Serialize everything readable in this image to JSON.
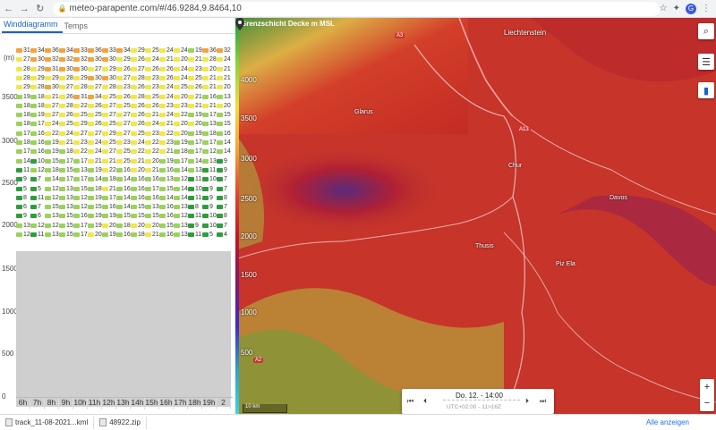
{
  "browser": {
    "url": "meteo-parapente.com/#/46.9284,9.8464,10",
    "back_icon": "arrow-left-icon",
    "forward_icon": "arrow-right-icon",
    "reload_icon": "reload-icon",
    "avatar_letter": "G"
  },
  "tabs": [
    {
      "label": "Winddiagramm",
      "active": true
    },
    {
      "label": "Temps",
      "active": false
    }
  ],
  "diagram": {
    "unit_label": "(m)",
    "y_labels": [
      "3500",
      "3000",
      "2500",
      "2000",
      "1500",
      "1000",
      "500",
      "0"
    ],
    "x_labels": [
      "6h",
      "7h",
      "8h",
      "9h",
      "10h",
      "11h",
      "12h",
      "13h",
      "14h",
      "15h",
      "16h",
      "17h",
      "18h",
      "19h",
      "2"
    ],
    "rows": [
      [
        "31",
        "34",
        "36",
        "34",
        "33",
        "36",
        "33",
        "34",
        "29",
        "25",
        "24",
        "24",
        "19",
        "36",
        "32"
      ],
      [
        "27",
        "30",
        "32",
        "32",
        "32",
        "30",
        "30",
        "29",
        "26",
        "24",
        "21",
        "20",
        "21",
        "28",
        "24"
      ],
      [
        "28",
        "29",
        "31",
        "30",
        "30",
        "27",
        "29",
        "26",
        "27",
        "26",
        "26",
        "24",
        "23",
        "20",
        "21"
      ],
      [
        "28",
        "29",
        "29",
        "28",
        "29",
        "30",
        "30",
        "27",
        "28",
        "23",
        "26",
        "24",
        "25",
        "21",
        "21"
      ],
      [
        "29",
        "28",
        "30",
        "27",
        "28",
        "27",
        "28",
        "23",
        "26",
        "23",
        "24",
        "25",
        "26",
        "21",
        "20"
      ],
      [
        "19",
        "18",
        "21",
        "26",
        "31",
        "34",
        "25",
        "26",
        "28",
        "25",
        "24",
        "20",
        "21",
        "16",
        "13"
      ],
      [
        "18",
        "18",
        "27",
        "28",
        "22",
        "26",
        "27",
        "25",
        "26",
        "26",
        "23",
        "23",
        "21",
        "21",
        "20"
      ],
      [
        "18",
        "19",
        "27",
        "26",
        "25",
        "25",
        "27",
        "27",
        "26",
        "21",
        "24",
        "22",
        "19",
        "17",
        "15"
      ],
      [
        "18",
        "17",
        "24",
        "25",
        "29",
        "26",
        "25",
        "27",
        "26",
        "24",
        "21",
        "20",
        "20",
        "13",
        "15"
      ],
      [
        "17",
        "16",
        "22",
        "24",
        "27",
        "27",
        "29",
        "27",
        "25",
        "23",
        "22",
        "20",
        "19",
        "18",
        "16"
      ],
      [
        "18",
        "16",
        "19",
        "21",
        "23",
        "24",
        "25",
        "23",
        "24",
        "22",
        "23",
        "19",
        "17",
        "17",
        "14"
      ],
      [
        "17",
        "16",
        "19",
        "18",
        "22",
        "24",
        "27",
        "25",
        "22",
        "22",
        "21",
        "18",
        "17",
        "12",
        "14"
      ],
      [
        "14",
        "10",
        "15",
        "17",
        "17",
        "21",
        "21",
        "25",
        "21",
        "20",
        "19",
        "17",
        "14",
        "13",
        "9"
      ],
      [
        "11",
        "12",
        "18",
        "15",
        "13",
        "19",
        "22",
        "16",
        "20",
        "21",
        "16",
        "14",
        "13",
        "11",
        "9"
      ],
      [
        "9",
        "7",
        "14",
        "17",
        "17",
        "14",
        "18",
        "14",
        "16",
        "16",
        "13",
        "12",
        "11",
        "10",
        "7"
      ],
      [
        "5",
        "5",
        "12",
        "13",
        "15",
        "18",
        "21",
        "16",
        "16",
        "17",
        "15",
        "14",
        "10",
        "9",
        "7"
      ],
      [
        "8",
        "11",
        "12",
        "13",
        "12",
        "19",
        "17",
        "14",
        "16",
        "16",
        "14",
        "14",
        "11",
        "9",
        "8"
      ],
      [
        "6",
        "7",
        "15",
        "13",
        "12",
        "15",
        "16",
        "14",
        "15",
        "13",
        "16",
        "13",
        "8",
        "9",
        "7"
      ],
      [
        "9",
        "6",
        "13",
        "15",
        "16",
        "19",
        "19",
        "15",
        "15",
        "15",
        "16",
        "12",
        "11",
        "10",
        "8"
      ],
      [
        "13",
        "12",
        "12",
        "15",
        "17",
        "19",
        "20",
        "18",
        "20",
        "20",
        "15",
        "13",
        "9",
        "10",
        "7"
      ],
      [
        "12",
        "11",
        "13",
        "15",
        "17",
        "20",
        "19",
        "16",
        "18",
        "21",
        "16",
        "13",
        "11",
        "5",
        "4"
      ]
    ]
  },
  "map": {
    "title": "Grenzschicht Decke m MSL",
    "contour_labels": [
      "4000",
      "3500",
      "3000",
      "2500",
      "2000",
      "1500",
      "1000",
      "500"
    ],
    "places": [
      {
        "name": "Liechtenstein"
      },
      {
        "name": "Glarus"
      },
      {
        "name": "Chur"
      },
      {
        "name": "Davos"
      },
      {
        "name": "Piz Ela"
      },
      {
        "name": "Thusis"
      }
    ],
    "road_badges": [
      "A3",
      "A13",
      "A2"
    ],
    "scale": "10 km",
    "player": {
      "title": "Do. 12. - 14:00",
      "subtitle": "UTC+02:00 - 11>16Z"
    },
    "accent": "#c0392b"
  },
  "downloads": {
    "items": [
      "track_11-08-2021...kml",
      "48922.zip"
    ],
    "more_label": "Alle anzeigen"
  }
}
